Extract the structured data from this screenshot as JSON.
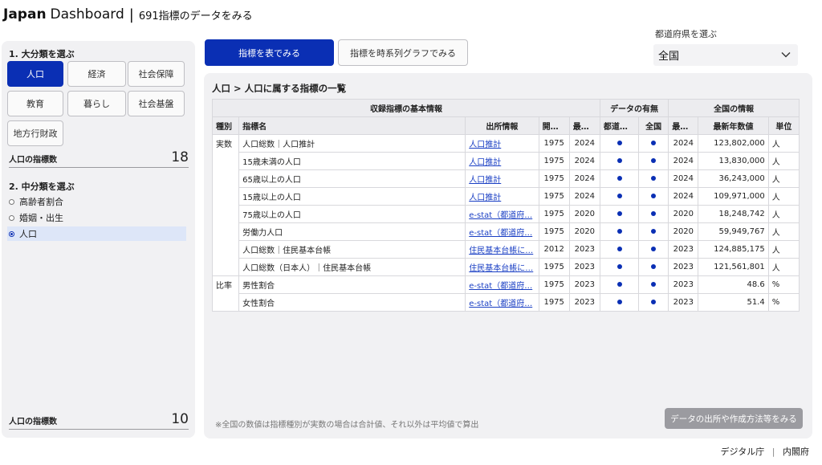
{
  "header": {
    "brand_strong": "Japan",
    "brand_light": "Dashboard",
    "separator": "|",
    "subtitle": "691指標のデータをみる"
  },
  "sidebar": {
    "section1_label": "1. 大分類を選ぶ",
    "categories": [
      {
        "label": "人口",
        "active": true
      },
      {
        "label": "経済",
        "active": false
      },
      {
        "label": "社会保障",
        "active": false
      },
      {
        "label": "教育",
        "active": false
      },
      {
        "label": "暮らし",
        "active": false
      },
      {
        "label": "社会基盤",
        "active": false
      },
      {
        "label": "地方行財政",
        "active": false
      }
    ],
    "count1_label": "人口の指標数",
    "count1_value": "18",
    "section2_label": "2. 中分類を選ぶ",
    "subcategories": [
      {
        "label": "高齢者割合",
        "selected": false
      },
      {
        "label": "婚姻・出生",
        "selected": false
      },
      {
        "label": "人口",
        "selected": true
      }
    ],
    "count2_label": "人口の指標数",
    "count2_value": "10"
  },
  "view_buttons": {
    "table": "指標を表でみる",
    "graph": "指標を時系列グラフでみる"
  },
  "prefecture": {
    "label": "都道府県を選ぶ",
    "selected": "全国"
  },
  "main": {
    "breadcrumb": "人口 > 人口に属する指標の一覧",
    "group_headers": {
      "basic": "収録指標の基本情報",
      "availability": "データの有無",
      "national": "全国の情報"
    },
    "columns": [
      "種別",
      "指標名",
      "出所情報",
      "開始年",
      "最新年",
      "都道府県",
      "全国",
      "最新年",
      "最新年数値",
      "単位"
    ],
    "rows": [
      {
        "kind": "実数",
        "name": "人口総数｜人口推計",
        "source": "人口推計",
        "start": "1975",
        "latest": "2024",
        "pref": true,
        "nat": true,
        "nat_year": "2024",
        "value": "123,802,000",
        "unit": "人"
      },
      {
        "kind": "",
        "name": "15歳未満の人口",
        "source": "人口推計",
        "start": "1975",
        "latest": "2024",
        "pref": true,
        "nat": true,
        "nat_year": "2024",
        "value": "13,830,000",
        "unit": "人"
      },
      {
        "kind": "",
        "name": "65歳以上の人口",
        "source": "人口推計",
        "start": "1975",
        "latest": "2024",
        "pref": true,
        "nat": true,
        "nat_year": "2024",
        "value": "36,243,000",
        "unit": "人"
      },
      {
        "kind": "",
        "name": "15歳以上の人口",
        "source": "人口推計",
        "start": "1975",
        "latest": "2024",
        "pref": true,
        "nat": true,
        "nat_year": "2024",
        "value": "109,971,000",
        "unit": "人"
      },
      {
        "kind": "",
        "name": "75歳以上の人口",
        "source": "e-stat（都道府…",
        "start": "1975",
        "latest": "2020",
        "pref": true,
        "nat": true,
        "nat_year": "2020",
        "value": "18,248,742",
        "unit": "人"
      },
      {
        "kind": "",
        "name": "労働力人口",
        "source": "e-stat（都道府…",
        "start": "1975",
        "latest": "2020",
        "pref": true,
        "nat": true,
        "nat_year": "2020",
        "value": "59,949,767",
        "unit": "人"
      },
      {
        "kind": "",
        "name": "人口総数｜住民基本台帳",
        "source": "住民基本台帳に…",
        "start": "2012",
        "latest": "2023",
        "pref": true,
        "nat": true,
        "nat_year": "2023",
        "value": "124,885,175",
        "unit": "人"
      },
      {
        "kind": "",
        "name": "人口総数（日本人）｜住民基本台帳",
        "source": "住民基本台帳に…",
        "start": "1975",
        "latest": "2023",
        "pref": true,
        "nat": true,
        "nat_year": "2023",
        "value": "121,561,801",
        "unit": "人"
      },
      {
        "kind": "比率",
        "name": "男性割合",
        "source": "e-stat（都道府…",
        "start": "1975",
        "latest": "2023",
        "pref": true,
        "nat": true,
        "nat_year": "2023",
        "value": "48.6",
        "unit": "%"
      },
      {
        "kind": "",
        "name": "女性割合",
        "source": "e-stat（都道府…",
        "start": "1975",
        "latest": "2023",
        "pref": true,
        "nat": true,
        "nat_year": "2023",
        "value": "51.4",
        "unit": "%"
      }
    ],
    "footnote": "※全国の数値は指標種別が実数の場合は合計値、それ以外は平均値で算出",
    "detail_button": "データの出所や作成方法等をみる"
  },
  "footer": {
    "left": "デジタル庁",
    "separator": "|",
    "right": "内閣府"
  },
  "colors": {
    "accent": "#0a2fb4",
    "panel_bg": "#f1f1f3",
    "link": "#1a3fc4",
    "disabled_button": "#9b9ba0"
  },
  "icons": {
    "select_chevron": "chevron-down-icon",
    "availability_mark": "dot-icon"
  }
}
